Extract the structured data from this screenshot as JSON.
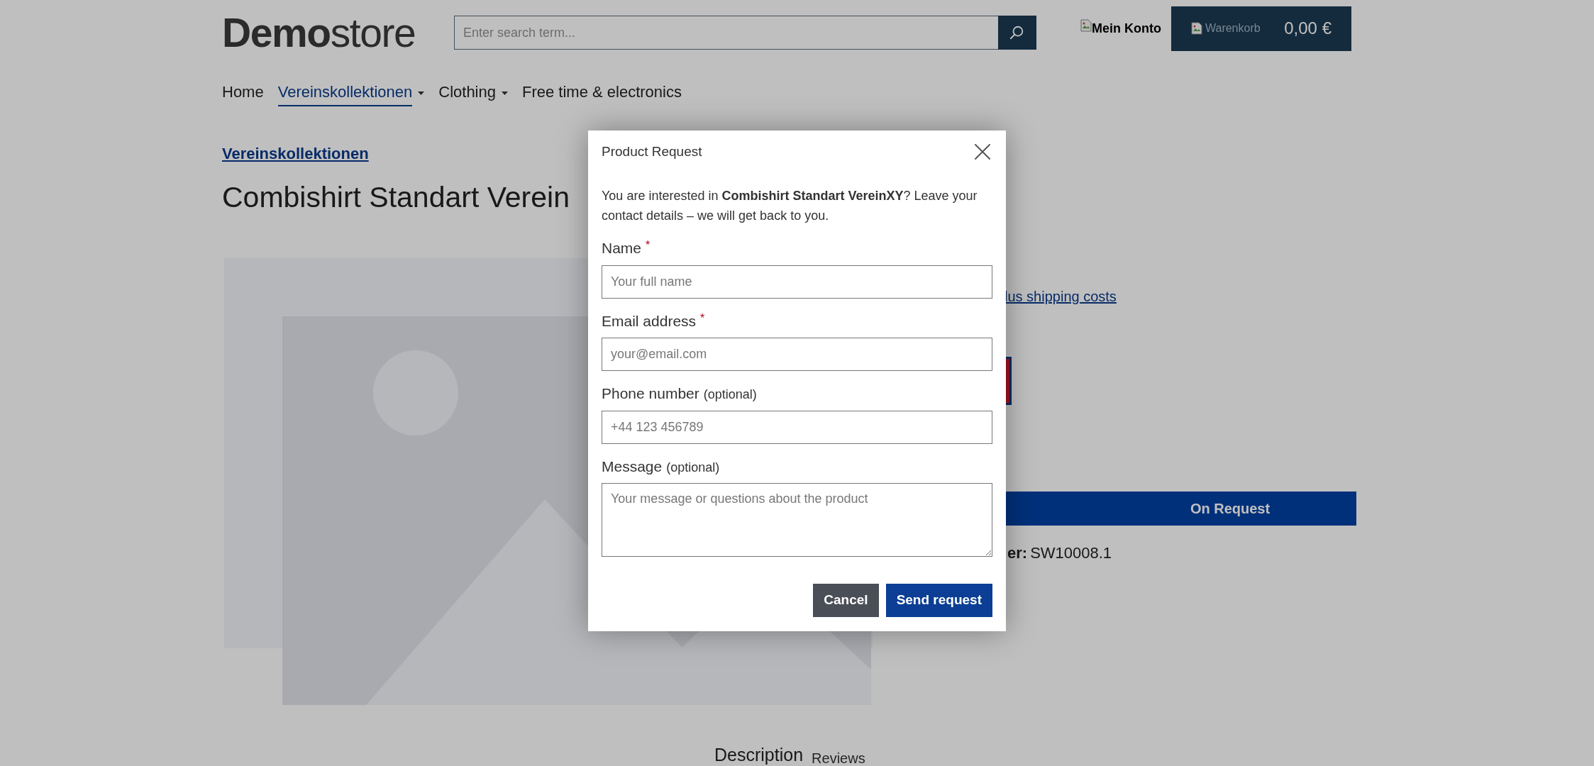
{
  "header": {
    "logo": {
      "strong": "Demo",
      "light": "store"
    },
    "search": {
      "placeholder": "Enter search term..."
    },
    "account": {
      "label": "Mein Konto"
    },
    "cart": {
      "alt": "Warenkorb",
      "total": "0,00 €"
    }
  },
  "nav": [
    {
      "label": "Home",
      "selected": false,
      "dropdown": false
    },
    {
      "label": "Vereinskollektionen",
      "selected": true,
      "dropdown": true
    },
    {
      "label": "Clothing",
      "selected": false,
      "dropdown": true
    },
    {
      "label": "Free time & electronics",
      "selected": false,
      "dropdown": false
    }
  ],
  "breadcrumb": "Vereinskollektionen",
  "product": {
    "title": "Combishirt Standart Verein",
    "shipping_link": "lus shipping costs",
    "variants": [
      {
        "selected": true
      }
    ],
    "buy_button": "On Request",
    "order_number": {
      "label": "er:",
      "value": "SW10008.1"
    }
  },
  "tabs": [
    {
      "label": "Description",
      "selected": true
    },
    {
      "label": "Reviews",
      "selected": false
    }
  ],
  "modal": {
    "title": "Product Request",
    "intro": "You are interested in **Combishirt Standart VereinXY**? Leave your contact details – we will get back to you.",
    "fields": [
      {
        "kind": "input",
        "label": "Name",
        "required_mark": "*",
        "placeholder": "Your full name"
      },
      {
        "kind": "input",
        "label": "Email address",
        "required_mark": "*",
        "placeholder": "your@email.com"
      },
      {
        "kind": "input",
        "label": "Phone number",
        "note": "(optional)",
        "placeholder": "+44 123 456789"
      },
      {
        "kind": "textarea",
        "label": "Message",
        "note": "(optional)",
        "placeholder": "Your message or questions about the product"
      }
    ],
    "buttons": [
      {
        "kind": "secondary",
        "label": "Cancel"
      },
      {
        "kind": "primary",
        "label": "Send request"
      }
    ]
  }
}
